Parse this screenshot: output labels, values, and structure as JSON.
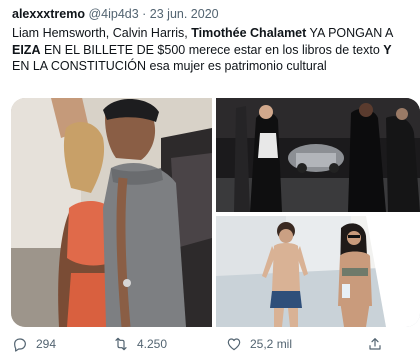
{
  "tweet": {
    "author_name": "alexxxtremo",
    "handle": "@4ip4d3",
    "separator": " · ",
    "date": "23 jun. 2020",
    "text_parts": {
      "t1": "Liam Hemsworth, Calvin Harris, ",
      "t2": "Timothée Chalamet",
      "t3": " YA PONGAN A ",
      "t4": "EIZA",
      "t5": " EN EL BILLETE DE $500 merece estar en los libros de texto ",
      "t6": "Y",
      "t7": " EN LA CONSTITUCIÓN esa mujer es patrimonio cultural"
    },
    "stats": {
      "replies": "294",
      "retweets": "4.250",
      "likes": "25,2 mil"
    }
  },
  "icons": {
    "reply": "speech-bubble-icon",
    "retweet": "retweet-arrows-icon",
    "like": "heart-icon",
    "share": "share-upload-icon"
  },
  "colors": {
    "text": "#0f1419",
    "secondary": "#536471"
  }
}
